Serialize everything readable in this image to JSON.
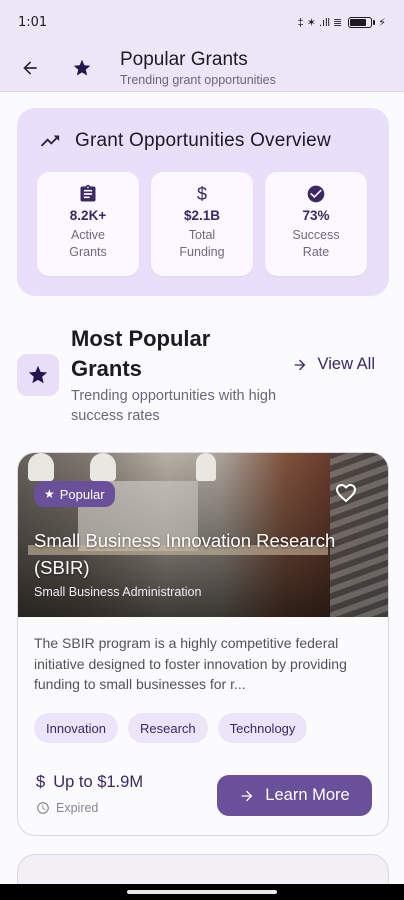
{
  "status_bar": {
    "time": "1:01",
    "icons_text": "‡ ✶ .ıll ≣"
  },
  "header": {
    "title": "Popular Grants",
    "subtitle": "Trending grant opportunities"
  },
  "overview": {
    "title": "Grant Opportunities Overview",
    "stats": [
      {
        "icon": "clipboard-icon",
        "value": "8.2K+",
        "label": "Active Grants"
      },
      {
        "icon": "dollar-icon",
        "value": "$2.1B",
        "label": "Total Funding"
      },
      {
        "icon": "check-circle-icon",
        "value": "73%",
        "label": "Success Rate"
      }
    ]
  },
  "section": {
    "title": "Most Popular Grants",
    "subtitle": "Trending opportunities with high success rates",
    "view_all": "View All"
  },
  "card": {
    "badge": "Popular",
    "title": "Small Business Innovation Research (SBIR)",
    "agency": "Small Business Administration",
    "description": "The SBIR program is a highly competitive federal initiative designed to foster innovation by providing funding to small businesses for r...",
    "tags": [
      "Innovation",
      "Research",
      "Technology"
    ],
    "amount": "Up to $1.9M",
    "deadline": "Expired",
    "cta": "Learn More"
  },
  "colors": {
    "primary": "#6a4f9a",
    "accent_bg": "#e9dffb",
    "dark_text": "#3b2864"
  }
}
